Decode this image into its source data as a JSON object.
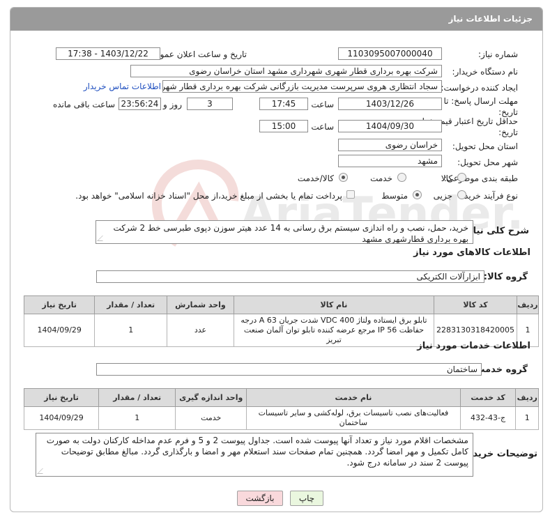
{
  "header": {
    "title": "جزئیات اطلاعات نیاز"
  },
  "fields": {
    "need_number_label": "شماره نیاز:",
    "need_number": "1103095007000040",
    "announce_label": "تاریخ و ساعت اعلان عمومی:",
    "announce_value": "1403/12/22 - 17:38",
    "buyer_org_label": "نام دستگاه خریدار:",
    "buyer_org": "شرکت بهره برداری قطار شهری شهرداری مشهد استان خراسان رضوی",
    "requester_label": "ایجاد کننده درخواست:",
    "requester": "سجاد انتظاری هروی سرپرست مدیریت بازرگانی شرکت بهره برداری قطار شهری",
    "contact_link": "اطلاعات تماس خریدار",
    "deadline_label_1": "مهلت ارسال پاسخ: تا",
    "deadline_label_2": "تاریخ:",
    "deadline_date": "1403/12/26",
    "time_label": "ساعت",
    "deadline_time": "17:45",
    "days_value": "3",
    "days_label": "روز و",
    "remaining_time": "23:56:24",
    "remaining_label": "ساعت باقی مانده",
    "validity_label_1": "حداقل تاریخ اعتبار قیمت: تا",
    "validity_label_2": "تاریخ:",
    "validity_date": "1404/09/30",
    "validity_time_label": "ساعت",
    "validity_time": "15:00",
    "province_label": "استان محل تحویل:",
    "province": "خراسان رضوی",
    "city_label": "شهر محل تحویل:",
    "city": "مشهد",
    "category_label": "طبقه بندی موضوعی:",
    "category_options": [
      "کالا",
      "خدمت",
      "کالا/خدمت"
    ],
    "process_label": "نوع فرآیند خرید :",
    "process_options": [
      "جزیی",
      "متوسط"
    ],
    "payment_note": "پرداخت تمام یا بخشی از مبلغ خرید،از محل \"اسناد خزانه اسلامی\" خواهد بود."
  },
  "description": {
    "label": "شرح کلی نیاز:",
    "text": "خرید، حمل، نصب و راه اندازی سیستم برق رسانی به 14 عدد هیتر سوزن دپوی طبرسی خط 2 شرکت بهره برداری قطارشهری مشهد"
  },
  "goods": {
    "section_title": "اطلاعات کالاهای مورد نیاز",
    "group_label": "گروه کالا:",
    "group_value": "ابزارآلات الکتریکی",
    "headers": [
      "ردیف",
      "کد کالا",
      "نام کالا",
      "واحد شمارش",
      "تعداد / مقدار",
      "تاریخ نیاز"
    ],
    "rows": [
      {
        "index": "1",
        "code": "2283130318420005",
        "name": "تابلو برق ایستاده ولتاژ VDC 400 شدت جریان A 63 درجه حفاظت IP 56 مرجع عرضه کننده تابلو توان آلمان صنعت تبریز",
        "unit": "عدد",
        "qty": "1",
        "date": "1404/09/29"
      }
    ]
  },
  "services": {
    "section_title": "اطلاعات خدمات مورد نیاز",
    "group_label": "گروه خدمت:",
    "group_value": "ساختمان",
    "headers": [
      "ردیف",
      "کد خدمت",
      "نام خدمت",
      "واحد اندازه گیری",
      "تعداد / مقدار",
      "تاریخ نیاز"
    ],
    "rows": [
      {
        "index": "1",
        "code": "ج-43-432",
        "name": "فعالیت‌های نصب تاسیسات برق، لوله‌کشی و سایر تاسیسات ساختمان",
        "unit": "خدمت",
        "qty": "1",
        "date": "1404/09/29"
      }
    ]
  },
  "buyer_notes": {
    "label": "توضیحات خریدار:",
    "text": "مشخصات اقلام مورد نیاز و تعداد آنها پیوست شده است. جداول پیوست 2 و 5 و فرم عدم مداخله کارکنان دولت به صورت کامل تکمیل و مهر امضا گردد. همچنین تمام صفحات سند استعلام مهر و امضا و بارگذاری گردد. مبالغ مطابق توضیحات پیوست 2 سند در سامانه درج شود."
  },
  "buttons": {
    "print": "چاپ",
    "back": "بازگشت"
  },
  "watermark": {
    "text": "AriaTender.neT"
  },
  "colors": {
    "header_bg": "#9a9a9a",
    "back_button_bg": "#f9d9dc",
    "print_button_bg": "#eaf7df",
    "link": "#1f4fbf"
  }
}
